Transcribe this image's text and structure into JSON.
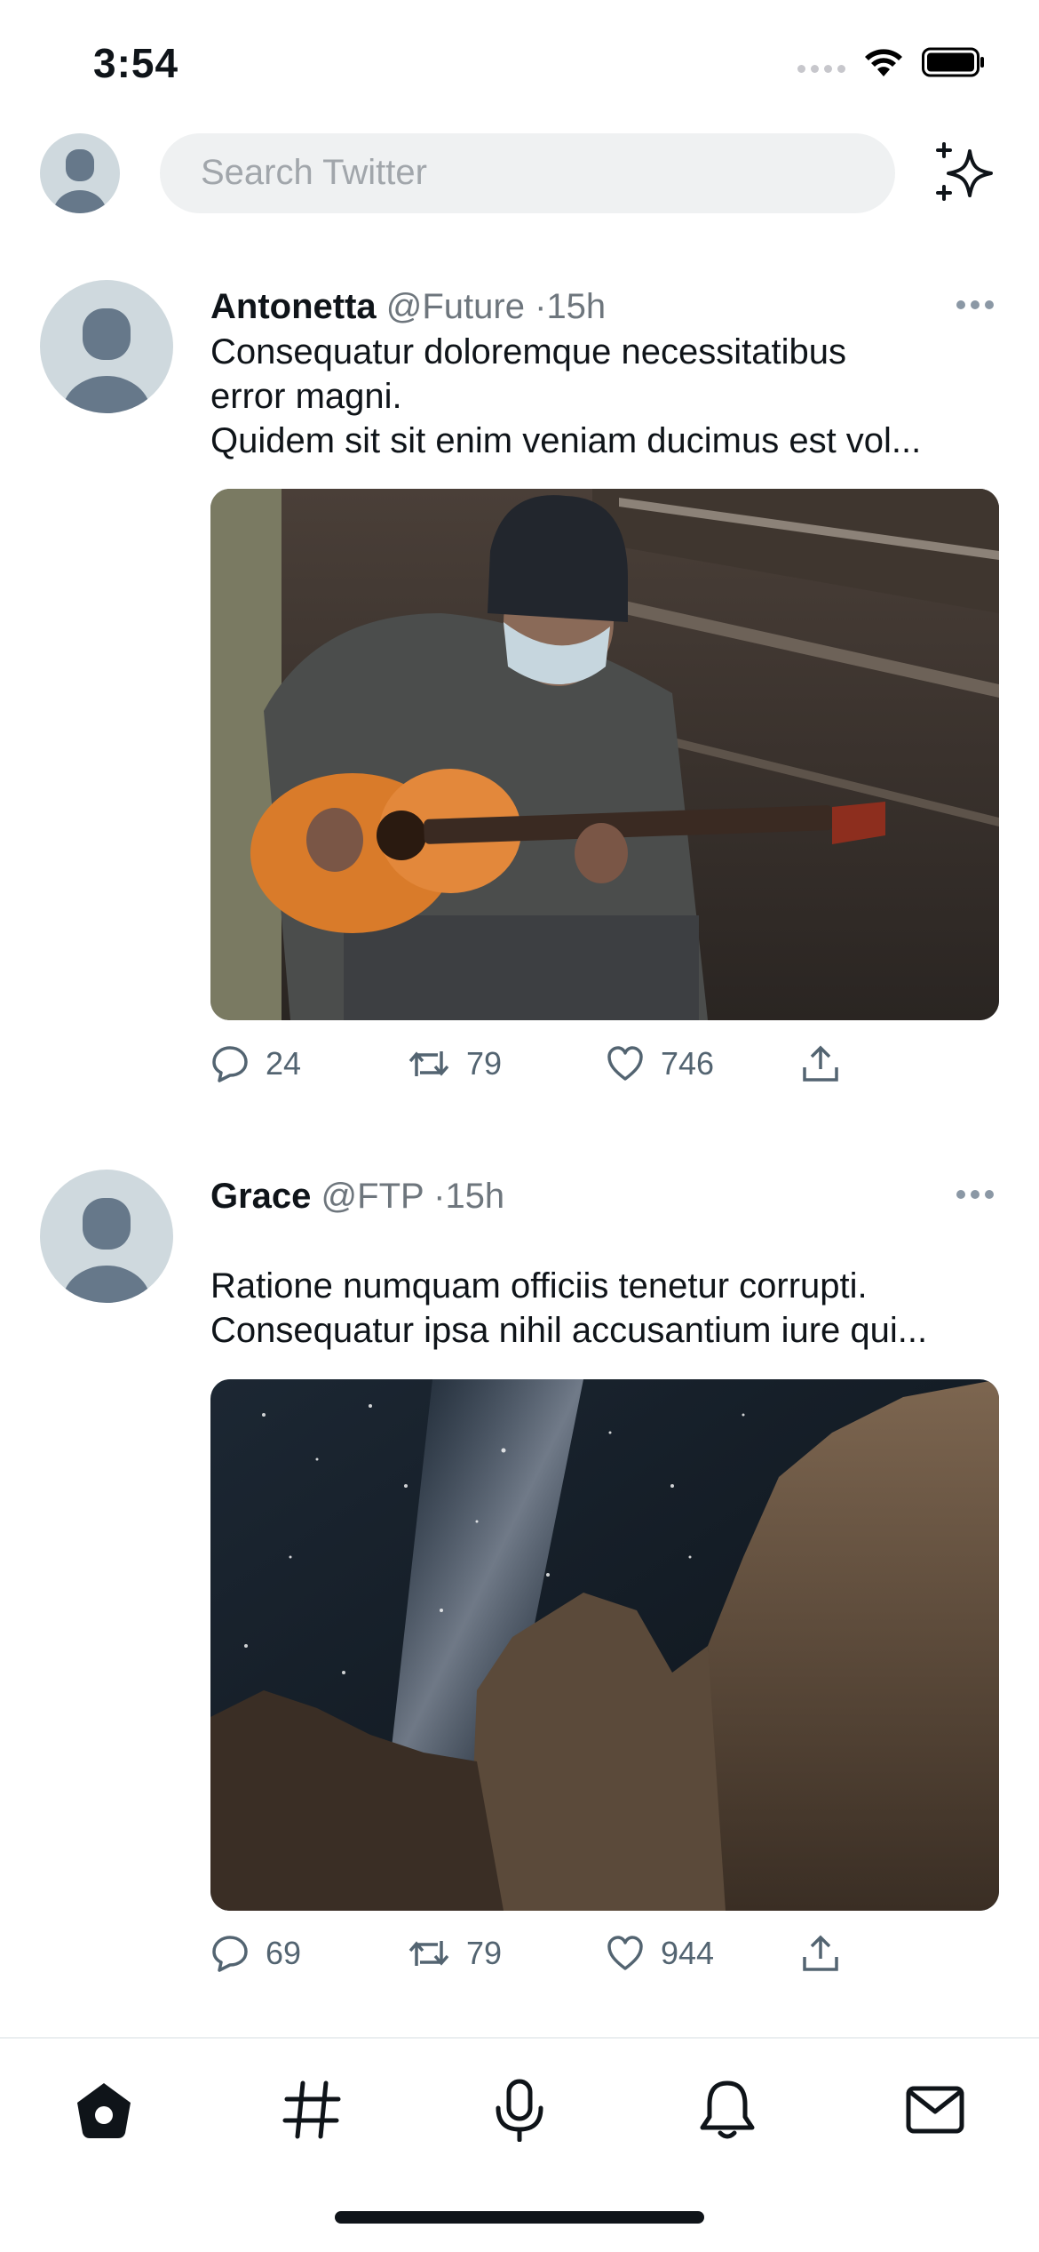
{
  "status_bar": {
    "time": "3:54"
  },
  "header": {
    "search_placeholder": "Search Twitter",
    "sparkle_icon": "sparkle-icon"
  },
  "tweets": [
    {
      "name": "Antonetta",
      "handle": "@Future",
      "dot": "·",
      "time": "15h",
      "lines": [
        "Consequatur doloremque necessitatibus",
        "error magni.",
        "Quidem sit sit enim veniam ducimus est vol..."
      ],
      "media": "man-in-mask-playing-guitar-photo",
      "replies": "24",
      "retweets": "79",
      "likes": "746"
    },
    {
      "name": "Grace",
      "handle": "@FTP",
      "dot": "·",
      "time": "15h",
      "lines": [
        "",
        "Ratione numquam officiis tenetur corrupti.",
        "Consequatur ipsa nihil accusantium iure qui..."
      ],
      "media": "milky-way-over-rock-cliffs-photo",
      "replies": "69",
      "retweets": "79",
      "likes": "944"
    }
  ],
  "tabbar": {
    "items": [
      "home-icon",
      "hashtag-icon",
      "microphone-icon",
      "bell-icon",
      "mail-icon"
    ]
  },
  "colors": {
    "text": "#0f1419",
    "secondary": "#6e767d",
    "avatar_bg": "#cfd9de",
    "avatar_fg": "#66788a",
    "search_bg": "#eff1f2"
  }
}
